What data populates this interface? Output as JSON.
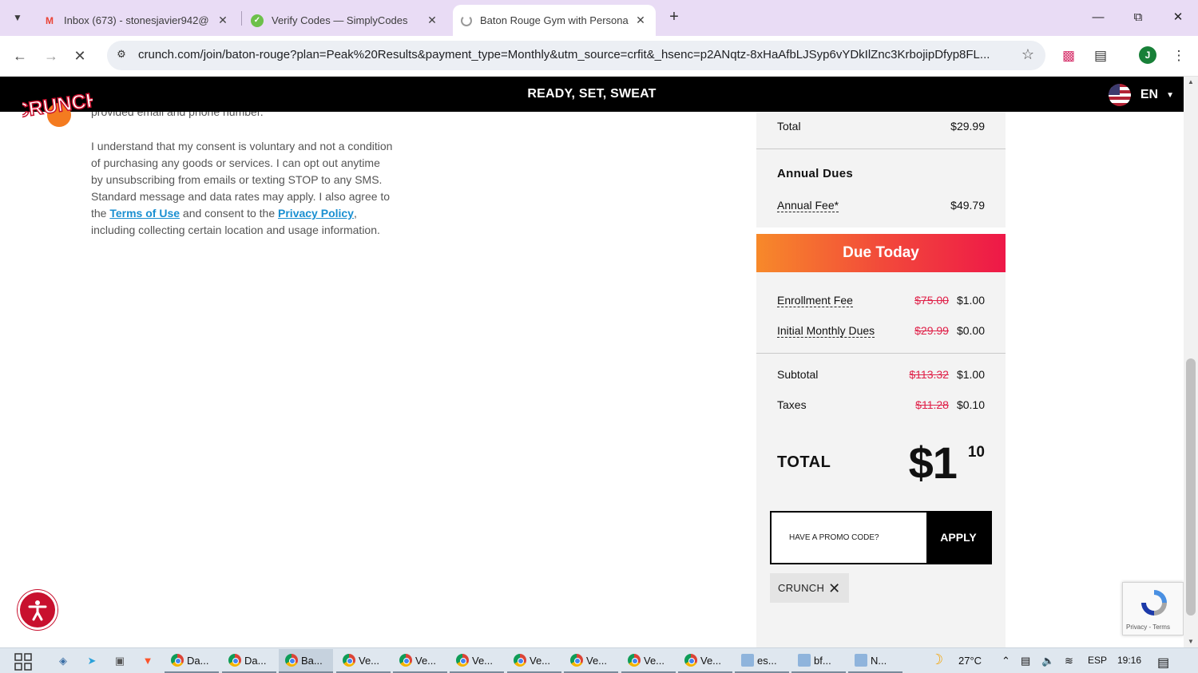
{
  "browser": {
    "tabs": [
      {
        "title": "Inbox (673) - stonesjavier942@",
        "favicon": "gmail-icon"
      },
      {
        "title": "Verify Codes — SimplyCodes",
        "favicon": "simplycodes-icon"
      },
      {
        "title": "Baton Rouge Gym with Persona",
        "favicon": "loading-icon"
      }
    ],
    "url": "crunch.com/join/baton-rouge?plan=Peak%20Results&payment_type=Monthly&utm_source=crfit&_hsenc=p2ANqtz-8xHaAfbLJSyp6vYDkIlZnc3KrbojipDfyp8FL...",
    "profile_initial": "J"
  },
  "site": {
    "logo_text": "CRUNCH",
    "tagline": "READY, SET, SWEAT",
    "language": "EN"
  },
  "consent": {
    "cut_line": "provided email and phone number.",
    "p1": "I understand that my consent is voluntary and not a condition of purchasing any goods or services. I can opt out anytime by unsubscribing from emails or texting STOP to any SMS. Standard message and data rates may apply. I also agree to the ",
    "terms_link": "Terms of Use",
    "p2": " and consent to the ",
    "privacy_link": "Privacy Policy",
    "p3": ", including collecting certain location and usage information."
  },
  "summary": {
    "total_label": "Total",
    "total_value": "$29.99",
    "annual_title": "Annual Dues",
    "annual_fee_label": "Annual Fee*",
    "annual_fee_value": "$49.79",
    "due_today_title": "Due Today",
    "enrollment_label": "Enrollment Fee",
    "enrollment_old": "$75.00",
    "enrollment_new": "$1.00",
    "initial_label": "Initial Monthly Dues",
    "initial_old": "$29.99",
    "initial_new": "$0.00",
    "subtotal_label": "Subtotal",
    "subtotal_old": "$113.32",
    "subtotal_new": "$1.00",
    "taxes_label": "Taxes",
    "taxes_old": "$11.28",
    "taxes_new": "$0.10",
    "grand_label": "TOTAL",
    "grand_dollars": "$1",
    "grand_cents": "10",
    "promo_placeholder": "HAVE A PROMO CODE?",
    "apply_label": "APPLY",
    "applied_code": "CRUNCH"
  },
  "recaptcha": {
    "links": "Privacy - Terms"
  },
  "taskbar": {
    "apps": [
      "Da...",
      "Da...",
      "Ba...",
      "Ve...",
      "Ve...",
      "Ve...",
      "Ve...",
      "Ve...",
      "Ve...",
      "Ve...",
      "es...",
      "bf...",
      "N..."
    ],
    "weather": "27°C",
    "language": "ESP",
    "time": "19:16"
  },
  "colors": {
    "due_gradient_start": "#f7892a",
    "due_gradient_end": "#ee1848",
    "strike_color": "#e0224a",
    "link_color": "#1a8fd1",
    "tabstrip": "#e9dcf5"
  }
}
